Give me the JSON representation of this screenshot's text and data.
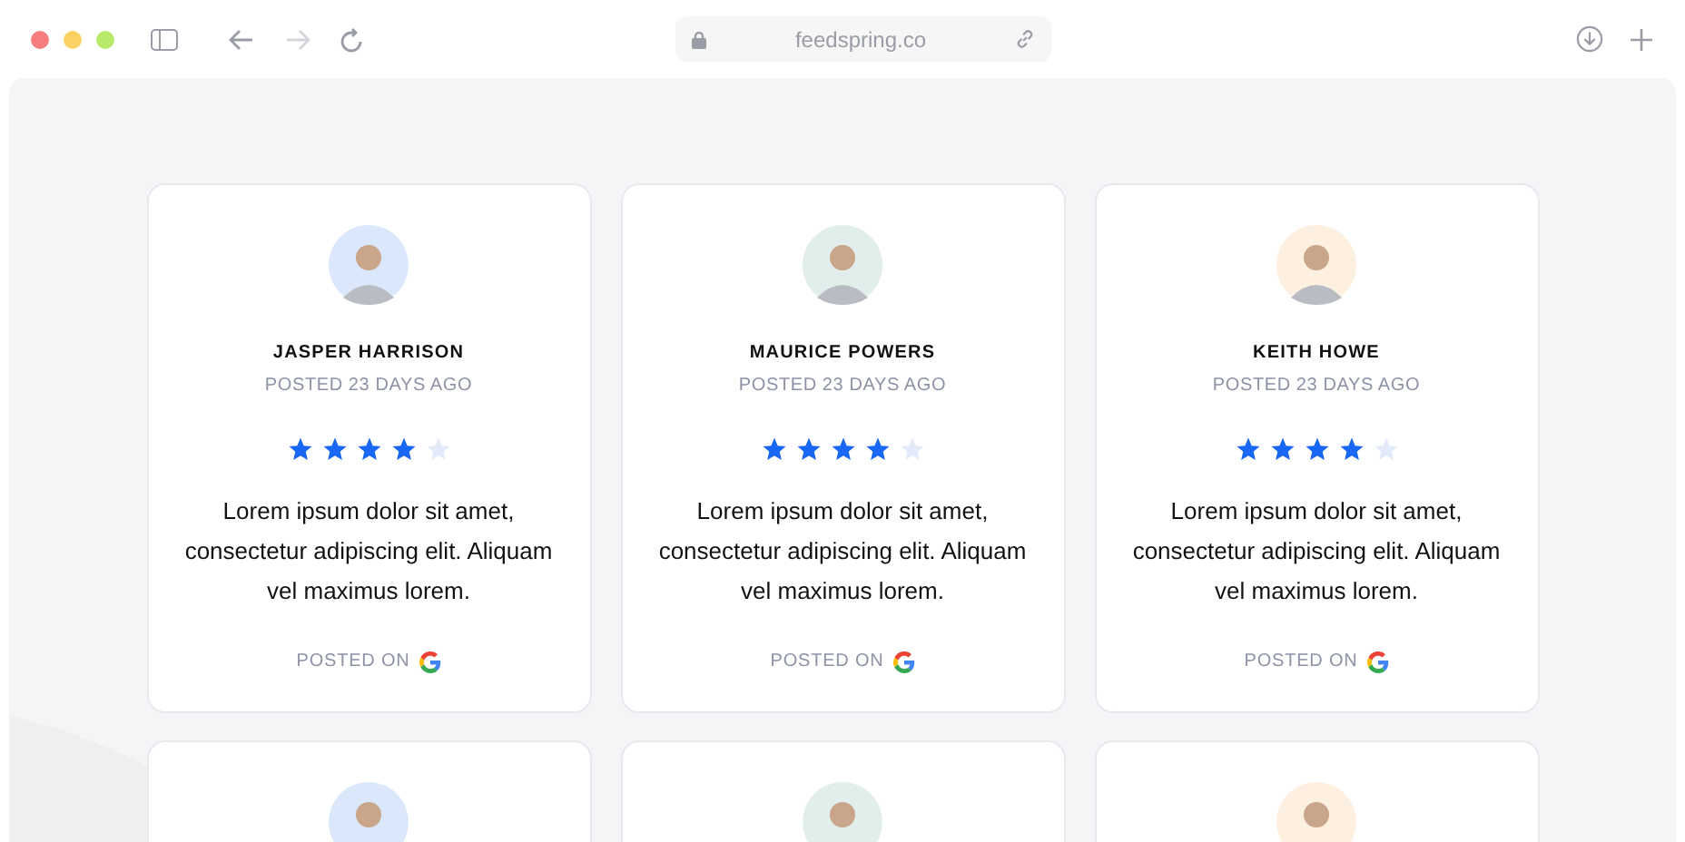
{
  "browser": {
    "url": "feedspring.co"
  },
  "reviews": [
    {
      "name": "JASPER HARRISON",
      "posted": "POSTED 23 DAYS AGO",
      "stars": 4,
      "text": "Lorem ipsum dolor sit amet, consectetur adipiscing elit. Aliquam vel maximus lorem.",
      "source_label": "POSTED ON",
      "color": "#dbe7fb"
    },
    {
      "name": "MAURICE POWERS",
      "posted": "POSTED 23 DAYS AGO",
      "stars": 4,
      "text": "Lorem ipsum dolor sit amet, consectetur adipiscing elit. Aliquam vel maximus lorem.",
      "source_label": "POSTED ON",
      "color": "#e1efec"
    },
    {
      "name": "KEITH HOWE",
      "posted": "POSTED 23 DAYS AGO",
      "stars": 4,
      "text": "Lorem ipsum dolor sit amet, consectetur adipiscing elit. Aliquam vel maximus lorem.",
      "source_label": "POSTED ON",
      "color": "#fdf0e1"
    }
  ],
  "more_reviews": [
    {
      "color": "#dbe7fb"
    },
    {
      "color": "#e1efec"
    },
    {
      "color": "#fdf0e1"
    }
  ]
}
